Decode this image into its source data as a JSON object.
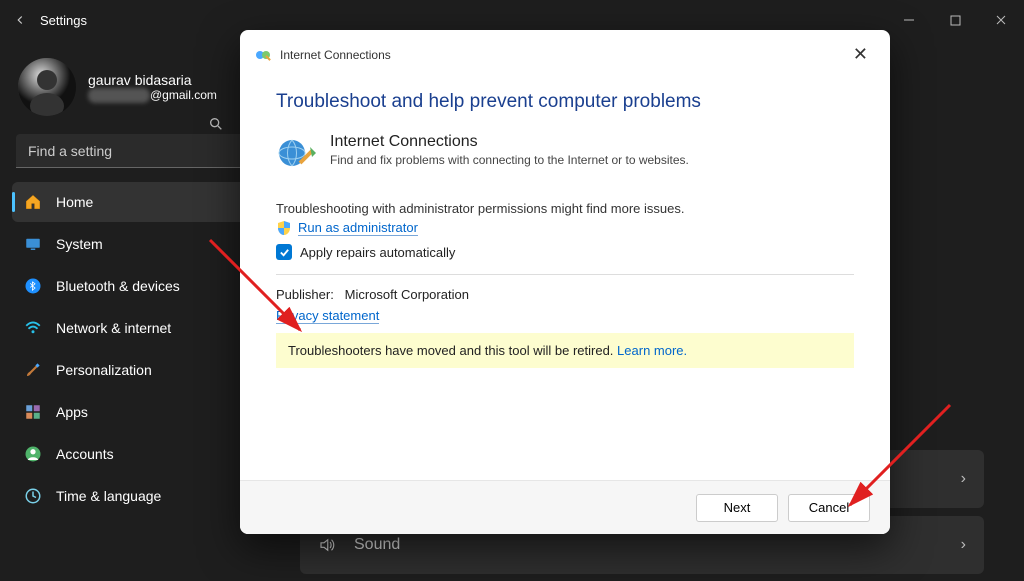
{
  "titlebar": {
    "title": "Settings"
  },
  "profile": {
    "name": "gaurav bidasaria",
    "email_suffix": "@gmail.com"
  },
  "search": {
    "placeholder": "Find a setting"
  },
  "nav": [
    {
      "label": "Home"
    },
    {
      "label": "System"
    },
    {
      "label": "Bluetooth & devices"
    },
    {
      "label": "Network & internet"
    },
    {
      "label": "Personalization"
    },
    {
      "label": "Apps"
    },
    {
      "label": "Accounts"
    },
    {
      "label": "Time & language"
    }
  ],
  "main_rows": [
    {
      "label": ""
    },
    {
      "label": "Sound"
    }
  ],
  "dialog": {
    "breadcrumb": "Internet Connections",
    "heading": "Troubleshoot and help prevent computer problems",
    "item_title": "Internet Connections",
    "item_desc": "Find and fix problems with connecting to the Internet or to websites.",
    "adm_text": "Troubleshooting with administrator permissions might find more issues.",
    "run_admin": "Run as administrator",
    "apply_label": "Apply repairs automatically",
    "publisher_label": "Publisher:",
    "publisher_value": "Microsoft Corporation",
    "privacy": "Privacy statement",
    "banner_text": "Troubleshooters have moved and this tool will be retired.",
    "banner_link": "Learn more.",
    "next": "Next",
    "cancel": "Cancel"
  }
}
